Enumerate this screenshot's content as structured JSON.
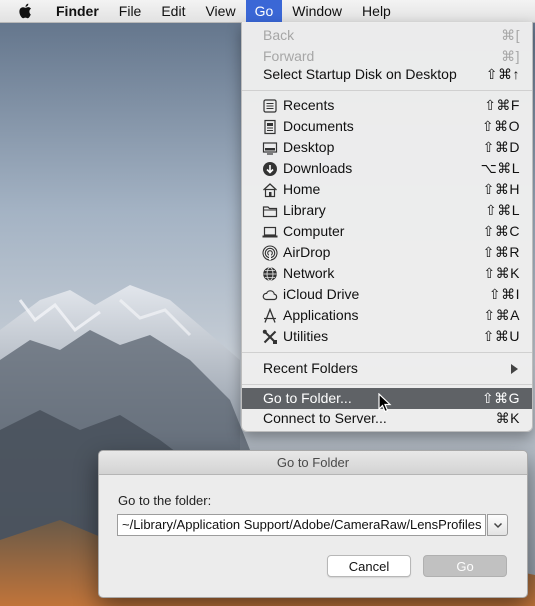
{
  "menubar": {
    "app_name": "Finder",
    "items": [
      "File",
      "Edit",
      "View",
      "Go",
      "Window",
      "Help"
    ]
  },
  "go_menu": {
    "back": {
      "label": "Back",
      "shortcut": "⌘["
    },
    "forward": {
      "label": "Forward",
      "shortcut": "⌘]"
    },
    "startup": {
      "label": "Select Startup Disk on Desktop",
      "shortcut": "⇧⌘↑"
    },
    "places": [
      {
        "label": "Recents",
        "shortcut": "⇧⌘F",
        "icon": "recents-icon"
      },
      {
        "label": "Documents",
        "shortcut": "⇧⌘O",
        "icon": "documents-icon"
      },
      {
        "label": "Desktop",
        "shortcut": "⇧⌘D",
        "icon": "desktop-icon"
      },
      {
        "label": "Downloads",
        "shortcut": "⌥⌘L",
        "icon": "downloads-icon"
      },
      {
        "label": "Home",
        "shortcut": "⇧⌘H",
        "icon": "home-icon"
      },
      {
        "label": "Library",
        "shortcut": "⇧⌘L",
        "icon": "library-folder-icon"
      },
      {
        "label": "Computer",
        "shortcut": "⇧⌘C",
        "icon": "computer-icon"
      },
      {
        "label": "AirDrop",
        "shortcut": "⇧⌘R",
        "icon": "airdrop-icon"
      },
      {
        "label": "Network",
        "shortcut": "⇧⌘K",
        "icon": "network-icon"
      },
      {
        "label": "iCloud Drive",
        "shortcut": "⇧⌘I",
        "icon": "icloud-icon"
      },
      {
        "label": "Applications",
        "shortcut": "⇧⌘A",
        "icon": "applications-icon"
      },
      {
        "label": "Utilities",
        "shortcut": "⇧⌘U",
        "icon": "utilities-icon"
      }
    ],
    "recent_folders": {
      "label": "Recent Folders"
    },
    "go_to_folder": {
      "label": "Go to Folder...",
      "shortcut": "⇧⌘G"
    },
    "connect": {
      "label": "Connect to Server...",
      "shortcut": "⌘K"
    }
  },
  "dialog": {
    "title": "Go to Folder",
    "prompt": "Go to the folder:",
    "path_value": "~/Library/Application Support/Adobe/CameraRaw/LensProfiles",
    "cancel_label": "Cancel",
    "go_label": "Go"
  },
  "colors": {
    "menu_highlight": "#5f6266",
    "active_menu": "#3a67d6",
    "disabled_text": "#a6a6a6"
  }
}
